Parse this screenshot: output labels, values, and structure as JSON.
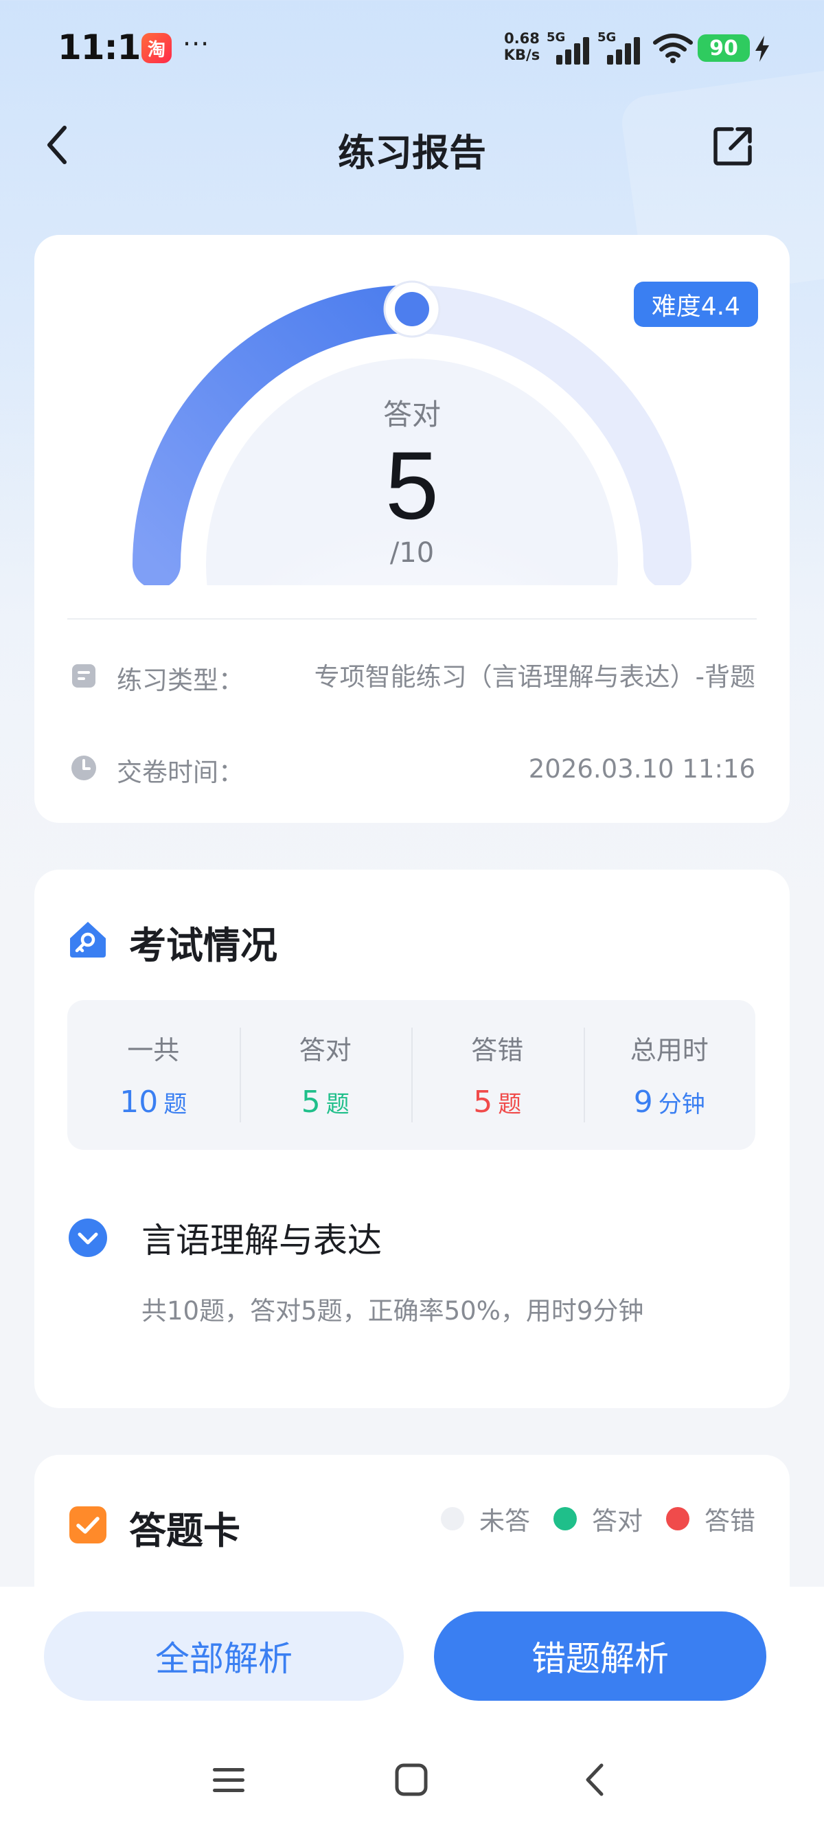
{
  "status_bar": {
    "time": "11:16",
    "app_badge": "淘",
    "more": "···",
    "net_speed_value": "0.68",
    "net_speed_unit": "KB/s",
    "signal_tag_1": "5G",
    "signal_tag_2": "5G",
    "battery": "90"
  },
  "header": {
    "title": "练习报告"
  },
  "report": {
    "difficulty": "难度4.4",
    "gauge_label": "答对",
    "correct": "5",
    "total": "/10",
    "correct_fraction": 0.5,
    "type_label": "练习类型：",
    "type_value": "专项智能练习（言语理解与表达）-背题",
    "time_label": "交卷时间：",
    "time_value": "2026.03.10 11:16"
  },
  "exam": {
    "title": "考试情况",
    "stats": [
      {
        "label": "一共",
        "value": "10",
        "unit": "题"
      },
      {
        "label": "答对",
        "value": "5",
        "unit": "题"
      },
      {
        "label": "答错",
        "value": "5",
        "unit": "题"
      },
      {
        "label": "总用时",
        "value": "9",
        "unit": "分钟"
      }
    ],
    "category": {
      "title": "言语理解与表达",
      "summary": "共10题，答对5题，正确率50%，用时9分钟"
    }
  },
  "answer_card": {
    "title": "答题卡",
    "legend": [
      {
        "label": "未答",
        "color": "#eef0f4"
      },
      {
        "label": "答对",
        "color": "#1fbf8a"
      },
      {
        "label": "答错",
        "color": "#f04b4b"
      }
    ]
  },
  "actions": {
    "all_analysis": "全部解析",
    "wrong_analysis": "错题解析"
  },
  "colors": {
    "accent": "#3a7ff2",
    "correct": "#1fbf8a",
    "wrong": "#f04b4b"
  }
}
